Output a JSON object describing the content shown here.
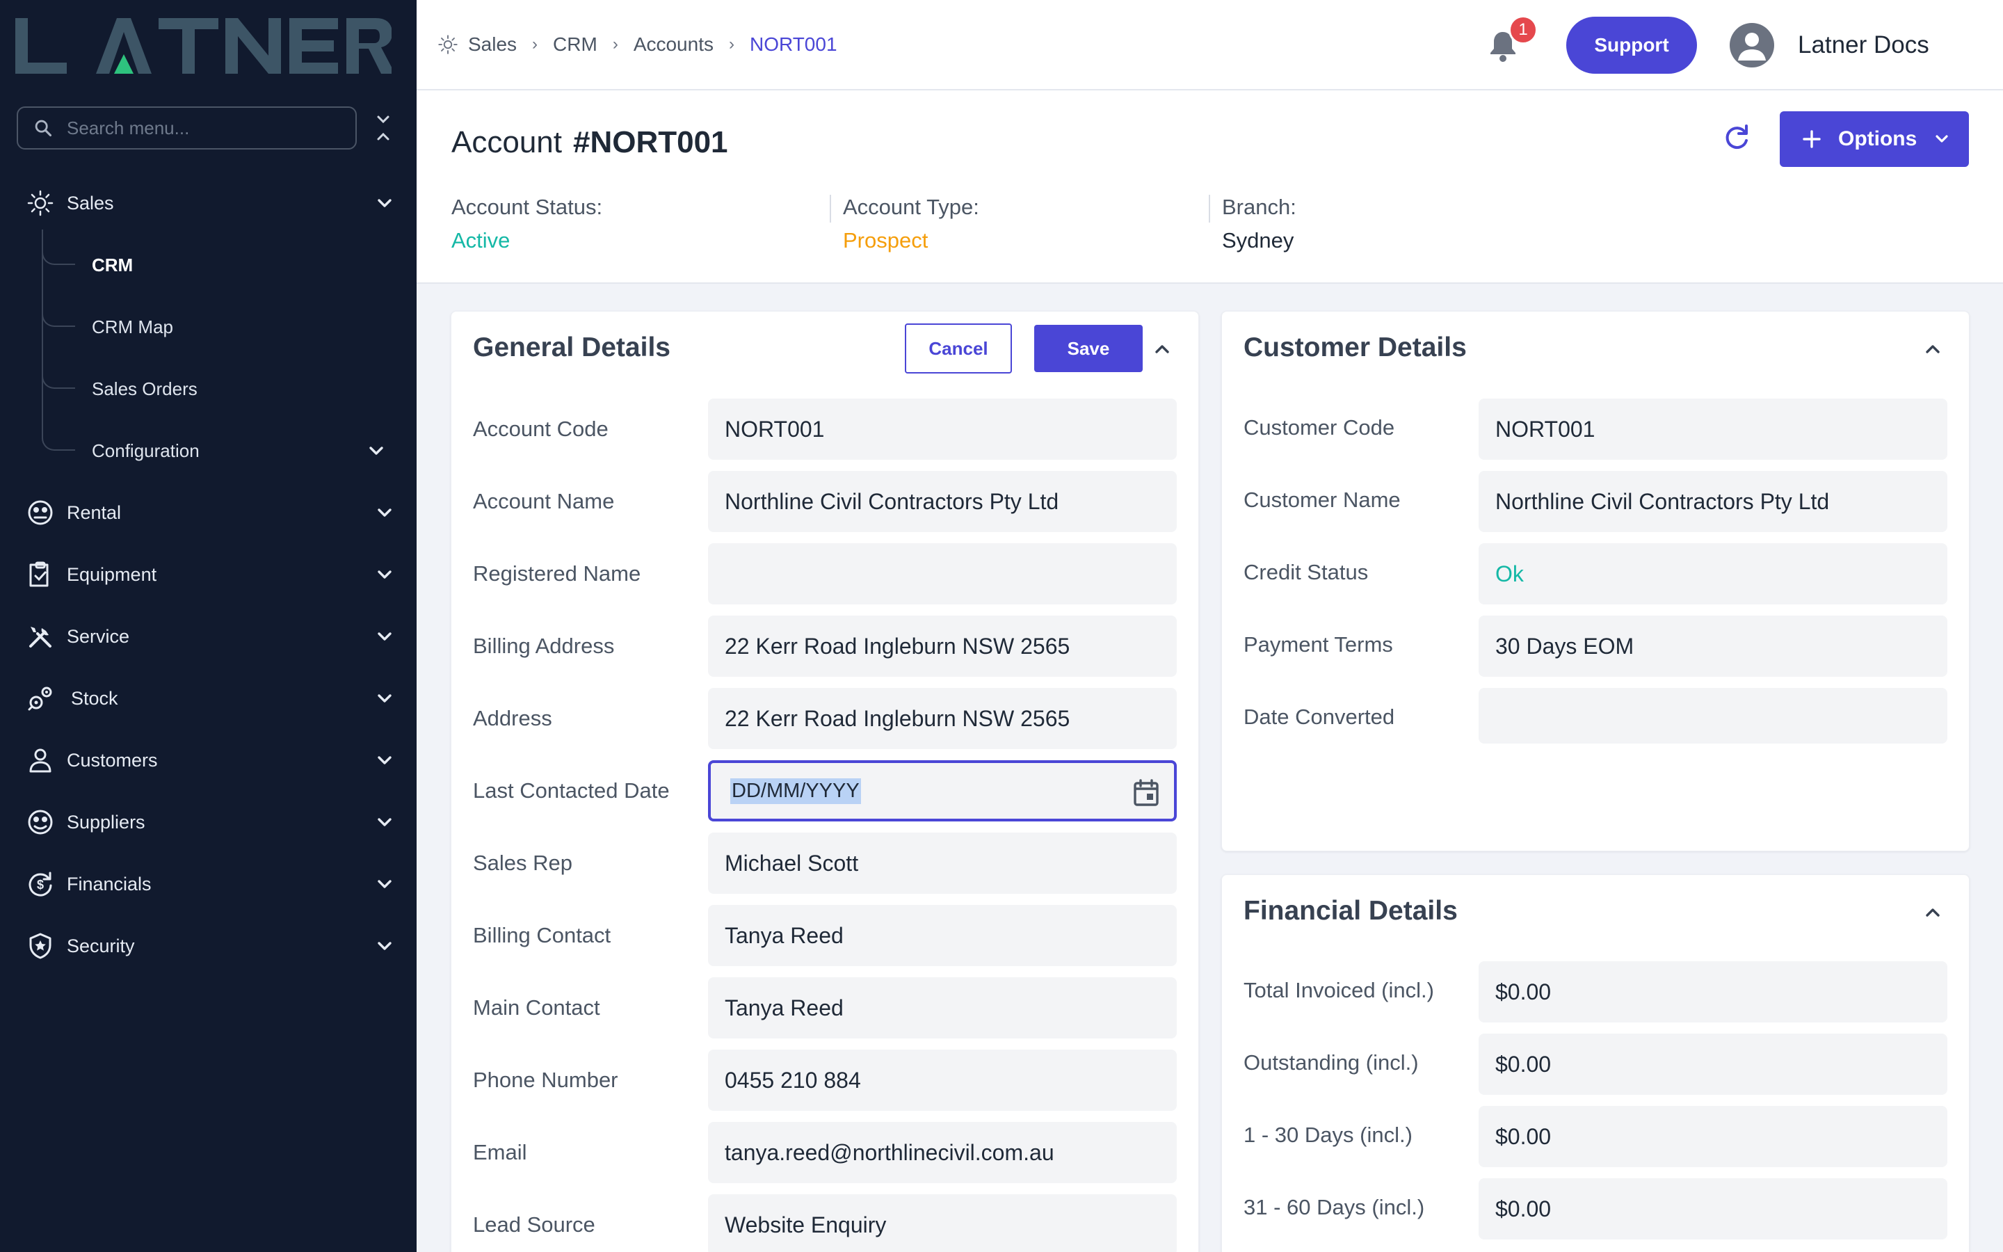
{
  "brand": {
    "logo_text": "LATNER"
  },
  "search": {
    "placeholder": "Search menu..."
  },
  "sidebar": {
    "items": [
      {
        "label": "Sales",
        "icon": "sales-sun-icon"
      },
      {
        "label": "Rental",
        "icon": "rental-icon"
      },
      {
        "label": "Equipment",
        "icon": "clipboard-check-icon"
      },
      {
        "label": "Service",
        "icon": "tools-icon"
      },
      {
        "label": "Stock",
        "icon": "gears-icon"
      },
      {
        "label": "Customers",
        "icon": "user-icon"
      },
      {
        "label": "Suppliers",
        "icon": "supplier-icon"
      },
      {
        "label": "Financials",
        "icon": "dollar-cycle-icon"
      },
      {
        "label": "Security",
        "icon": "shield-star-icon"
      }
    ],
    "sales_sub": [
      {
        "label": "CRM",
        "active": true
      },
      {
        "label": "CRM Map"
      },
      {
        "label": "Sales Orders"
      },
      {
        "label": "Configuration"
      }
    ]
  },
  "breadcrumb": [
    "Sales",
    "CRM",
    "Accounts",
    "NORT001"
  ],
  "topbar": {
    "notification_count": "1",
    "support_label": "Support",
    "user_name": "Latner Docs"
  },
  "header": {
    "title_prefix": "Account",
    "title_code": "#NORT001",
    "options_label": "Options",
    "stats": [
      {
        "label": "Account Status:",
        "value": "Active",
        "color": "#14b8a6"
      },
      {
        "label": "Account Type:",
        "value": "Prospect",
        "color": "#f59e0b"
      },
      {
        "label": "Branch:",
        "value": "Sydney",
        "color": "#1f2937"
      }
    ]
  },
  "general": {
    "title": "General Details",
    "cancel_label": "Cancel",
    "save_label": "Save",
    "fields": [
      {
        "label": "Account Code",
        "value": "NORT001"
      },
      {
        "label": "Account Name",
        "value": "Northline Civil Contractors Pty Ltd"
      },
      {
        "label": "Registered Name",
        "value": ""
      },
      {
        "label": "Billing Address",
        "value": "22 Kerr Road Ingleburn NSW 2565"
      },
      {
        "label": "Address",
        "value": "22 Kerr Road Ingleburn NSW 2565"
      },
      {
        "label": "Last Contacted Date",
        "value": "DD/MM/YYYY"
      },
      {
        "label": "Sales Rep",
        "value": "Michael Scott"
      },
      {
        "label": "Billing Contact",
        "value": "Tanya Reed"
      },
      {
        "label": "Main Contact",
        "value": "Tanya Reed"
      },
      {
        "label": "Phone Number",
        "value": "0455 210 884"
      },
      {
        "label": "Email",
        "value": "tanya.reed@northlinecivil.com.au"
      },
      {
        "label": "Lead Source",
        "value": "Website Enquiry"
      }
    ]
  },
  "customer": {
    "title": "Customer Details",
    "fields": [
      {
        "label": "Customer Code",
        "value": "NORT001"
      },
      {
        "label": "Customer Name",
        "value": "Northline Civil Contractors Pty Ltd"
      },
      {
        "label": "Credit Status",
        "value": "Ok"
      },
      {
        "label": "Payment Terms",
        "value": "30 Days EOM"
      },
      {
        "label": "Date Converted",
        "value": ""
      }
    ]
  },
  "financial": {
    "title": "Financial Details",
    "fields": [
      {
        "label": "Total Invoiced (incl.)",
        "value": "$0.00"
      },
      {
        "label": "Outstanding (incl.)",
        "value": "$0.00"
      },
      {
        "label": "1 - 30 Days (incl.)",
        "value": "$0.00"
      },
      {
        "label": "31 - 60 Days (incl.)",
        "value": "$0.00"
      }
    ]
  },
  "colors": {
    "accent": "#4a46d6",
    "sidebar_bg": "#111a2e",
    "logo": "#3d5566",
    "logo_accent": "#2ec27e"
  }
}
